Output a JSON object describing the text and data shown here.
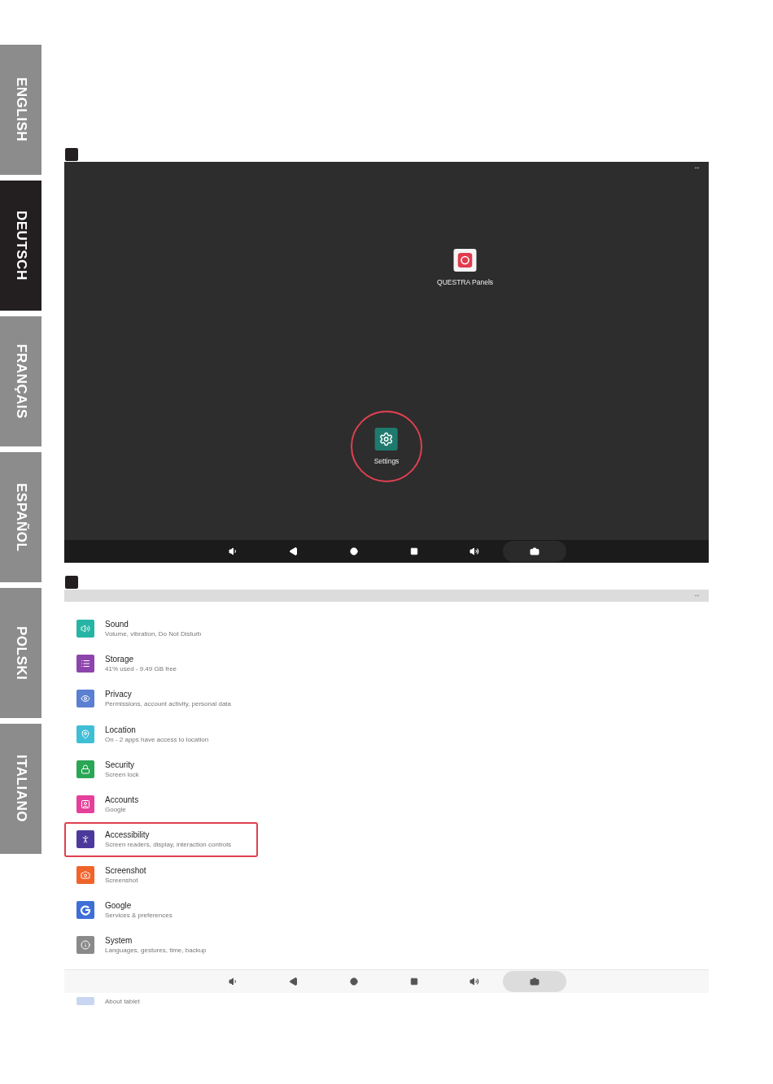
{
  "language_tabs": [
    {
      "label": "ENGLISH",
      "selected": false
    },
    {
      "label": "DEUTSCH",
      "selected": true
    },
    {
      "label": "FRANÇAIS",
      "selected": false
    },
    {
      "label": "ESPAÑOL",
      "selected": false
    },
    {
      "label": "POLSKI",
      "selected": false
    },
    {
      "label": "ITALIANO",
      "selected": false
    }
  ],
  "home_screen": {
    "resize_glyph": "↔",
    "apps": [
      {
        "label": "QUESTRA Panels",
        "highlighted": false
      },
      {
        "label": "Settings",
        "highlighted": true
      }
    ],
    "nav_buttons": [
      {
        "selected": false
      },
      {
        "selected": false
      },
      {
        "selected": false
      },
      {
        "selected": false
      },
      {
        "selected": false
      },
      {
        "selected": true
      }
    ]
  },
  "settings_screen": {
    "resize_glyph": "↔",
    "items": [
      {
        "title": "Sound",
        "subtitle": "Volume, vibration, Do Not Disturb",
        "color": "#26b5a5",
        "highlighted": false
      },
      {
        "title": "Storage",
        "subtitle": "41% used - 9.49 GB free",
        "color": "#8e44ad",
        "highlighted": false
      },
      {
        "title": "Privacy",
        "subtitle": "Permissions, account activity, personal data",
        "color": "#5b7fd1",
        "highlighted": false
      },
      {
        "title": "Location",
        "subtitle": "On - 2 apps have access to location",
        "color": "#3fbfd6",
        "highlighted": false
      },
      {
        "title": "Security",
        "subtitle": "Screen lock",
        "color": "#2aa655",
        "highlighted": false
      },
      {
        "title": "Accounts",
        "subtitle": "Google",
        "color": "#e5409a",
        "highlighted": false
      },
      {
        "title": "Accessibility",
        "subtitle": "Screen readers, display, interaction controls",
        "color": "#4b3a9c",
        "highlighted": true
      },
      {
        "title": "Screenshot",
        "subtitle": "Screenshot",
        "color": "#f0642c",
        "highlighted": false
      },
      {
        "title": "Google",
        "subtitle": "Services & preferences",
        "color": "#3d6fd6",
        "highlighted": false
      },
      {
        "title": "System",
        "subtitle": "Languages, gestures, time, backup",
        "color": "#8a8a8a",
        "highlighted": false
      }
    ],
    "peek_item": {
      "title": "About tablet"
    },
    "nav_buttons": [
      {
        "selected": false
      },
      {
        "selected": false
      },
      {
        "selected": false
      },
      {
        "selected": false
      },
      {
        "selected": false
      },
      {
        "selected": true
      }
    ]
  }
}
